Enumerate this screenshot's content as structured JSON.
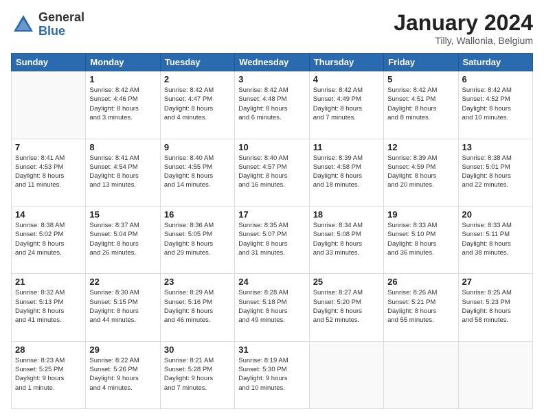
{
  "logo": {
    "general": "General",
    "blue": "Blue"
  },
  "header": {
    "month": "January 2024",
    "location": "Tilly, Wallonia, Belgium"
  },
  "days_of_week": [
    "Sunday",
    "Monday",
    "Tuesday",
    "Wednesday",
    "Thursday",
    "Friday",
    "Saturday"
  ],
  "weeks": [
    [
      {
        "day": "",
        "info": ""
      },
      {
        "day": "1",
        "info": "Sunrise: 8:42 AM\nSunset: 4:46 PM\nDaylight: 8 hours\nand 3 minutes."
      },
      {
        "day": "2",
        "info": "Sunrise: 8:42 AM\nSunset: 4:47 PM\nDaylight: 8 hours\nand 4 minutes."
      },
      {
        "day": "3",
        "info": "Sunrise: 8:42 AM\nSunset: 4:48 PM\nDaylight: 8 hours\nand 6 minutes."
      },
      {
        "day": "4",
        "info": "Sunrise: 8:42 AM\nSunset: 4:49 PM\nDaylight: 8 hours\nand 7 minutes."
      },
      {
        "day": "5",
        "info": "Sunrise: 8:42 AM\nSunset: 4:51 PM\nDaylight: 8 hours\nand 8 minutes."
      },
      {
        "day": "6",
        "info": "Sunrise: 8:42 AM\nSunset: 4:52 PM\nDaylight: 8 hours\nand 10 minutes."
      }
    ],
    [
      {
        "day": "7",
        "info": "Sunrise: 8:41 AM\nSunset: 4:53 PM\nDaylight: 8 hours\nand 11 minutes."
      },
      {
        "day": "8",
        "info": "Sunrise: 8:41 AM\nSunset: 4:54 PM\nDaylight: 8 hours\nand 13 minutes."
      },
      {
        "day": "9",
        "info": "Sunrise: 8:40 AM\nSunset: 4:55 PM\nDaylight: 8 hours\nand 14 minutes."
      },
      {
        "day": "10",
        "info": "Sunrise: 8:40 AM\nSunset: 4:57 PM\nDaylight: 8 hours\nand 16 minutes."
      },
      {
        "day": "11",
        "info": "Sunrise: 8:39 AM\nSunset: 4:58 PM\nDaylight: 8 hours\nand 18 minutes."
      },
      {
        "day": "12",
        "info": "Sunrise: 8:39 AM\nSunset: 4:59 PM\nDaylight: 8 hours\nand 20 minutes."
      },
      {
        "day": "13",
        "info": "Sunrise: 8:38 AM\nSunset: 5:01 PM\nDaylight: 8 hours\nand 22 minutes."
      }
    ],
    [
      {
        "day": "14",
        "info": "Sunrise: 8:38 AM\nSunset: 5:02 PM\nDaylight: 8 hours\nand 24 minutes."
      },
      {
        "day": "15",
        "info": "Sunrise: 8:37 AM\nSunset: 5:04 PM\nDaylight: 8 hours\nand 26 minutes."
      },
      {
        "day": "16",
        "info": "Sunrise: 8:36 AM\nSunset: 5:05 PM\nDaylight: 8 hours\nand 29 minutes."
      },
      {
        "day": "17",
        "info": "Sunrise: 8:35 AM\nSunset: 5:07 PM\nDaylight: 8 hours\nand 31 minutes."
      },
      {
        "day": "18",
        "info": "Sunrise: 8:34 AM\nSunset: 5:08 PM\nDaylight: 8 hours\nand 33 minutes."
      },
      {
        "day": "19",
        "info": "Sunrise: 8:33 AM\nSunset: 5:10 PM\nDaylight: 8 hours\nand 36 minutes."
      },
      {
        "day": "20",
        "info": "Sunrise: 8:33 AM\nSunset: 5:11 PM\nDaylight: 8 hours\nand 38 minutes."
      }
    ],
    [
      {
        "day": "21",
        "info": "Sunrise: 8:32 AM\nSunset: 5:13 PM\nDaylight: 8 hours\nand 41 minutes."
      },
      {
        "day": "22",
        "info": "Sunrise: 8:30 AM\nSunset: 5:15 PM\nDaylight: 8 hours\nand 44 minutes."
      },
      {
        "day": "23",
        "info": "Sunrise: 8:29 AM\nSunset: 5:16 PM\nDaylight: 8 hours\nand 46 minutes."
      },
      {
        "day": "24",
        "info": "Sunrise: 8:28 AM\nSunset: 5:18 PM\nDaylight: 8 hours\nand 49 minutes."
      },
      {
        "day": "25",
        "info": "Sunrise: 8:27 AM\nSunset: 5:20 PM\nDaylight: 8 hours\nand 52 minutes."
      },
      {
        "day": "26",
        "info": "Sunrise: 8:26 AM\nSunset: 5:21 PM\nDaylight: 8 hours\nand 55 minutes."
      },
      {
        "day": "27",
        "info": "Sunrise: 8:25 AM\nSunset: 5:23 PM\nDaylight: 8 hours\nand 58 minutes."
      }
    ],
    [
      {
        "day": "28",
        "info": "Sunrise: 8:23 AM\nSunset: 5:25 PM\nDaylight: 9 hours\nand 1 minute."
      },
      {
        "day": "29",
        "info": "Sunrise: 8:22 AM\nSunset: 5:26 PM\nDaylight: 9 hours\nand 4 minutes."
      },
      {
        "day": "30",
        "info": "Sunrise: 8:21 AM\nSunset: 5:28 PM\nDaylight: 9 hours\nand 7 minutes."
      },
      {
        "day": "31",
        "info": "Sunrise: 8:19 AM\nSunset: 5:30 PM\nDaylight: 9 hours\nand 10 minutes."
      },
      {
        "day": "",
        "info": ""
      },
      {
        "day": "",
        "info": ""
      },
      {
        "day": "",
        "info": ""
      }
    ]
  ]
}
